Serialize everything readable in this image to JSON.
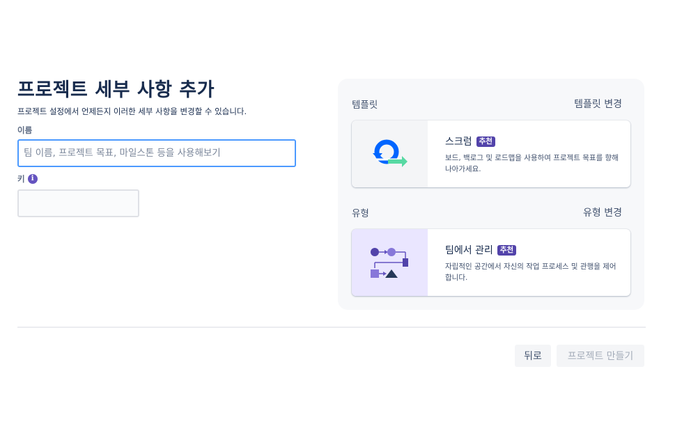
{
  "form": {
    "title": "프로젝트 세부 사항 추가",
    "subtitle": "프로젝트 설정에서 언제든지 이러한 세부 사항을 변경할 수 있습니다.",
    "name_label": "이름",
    "name_placeholder": "팀 이름, 프로젝트 목표, 마일스톤 등을 사용해보기",
    "name_value": "",
    "key_label": "키",
    "key_value": ""
  },
  "template": {
    "section_label": "템플릿",
    "change_label": "템플릿 변경",
    "card": {
      "title": "스크럼",
      "badge": "추천",
      "description": "보드, 백로그 및 로드맵을 사용하여 프로젝트 목표를 향해 나아가세요.",
      "icon": "scrum-cycle-icon"
    }
  },
  "type": {
    "section_label": "유형",
    "change_label": "유형 변경",
    "card": {
      "title": "팀에서 관리",
      "badge": "추천",
      "description": "자립적인 공간에서 자신의 작업 프로세스 및 관행을 제어합니다.",
      "icon": "team-managed-workflow-icon"
    }
  },
  "footer": {
    "back_label": "뒤로",
    "create_label": "프로젝트 만들기"
  },
  "colors": {
    "accent": "#4c9aff",
    "badge": "#5243aa",
    "heading": "#172b4d",
    "panel": "#f7f8fa"
  }
}
